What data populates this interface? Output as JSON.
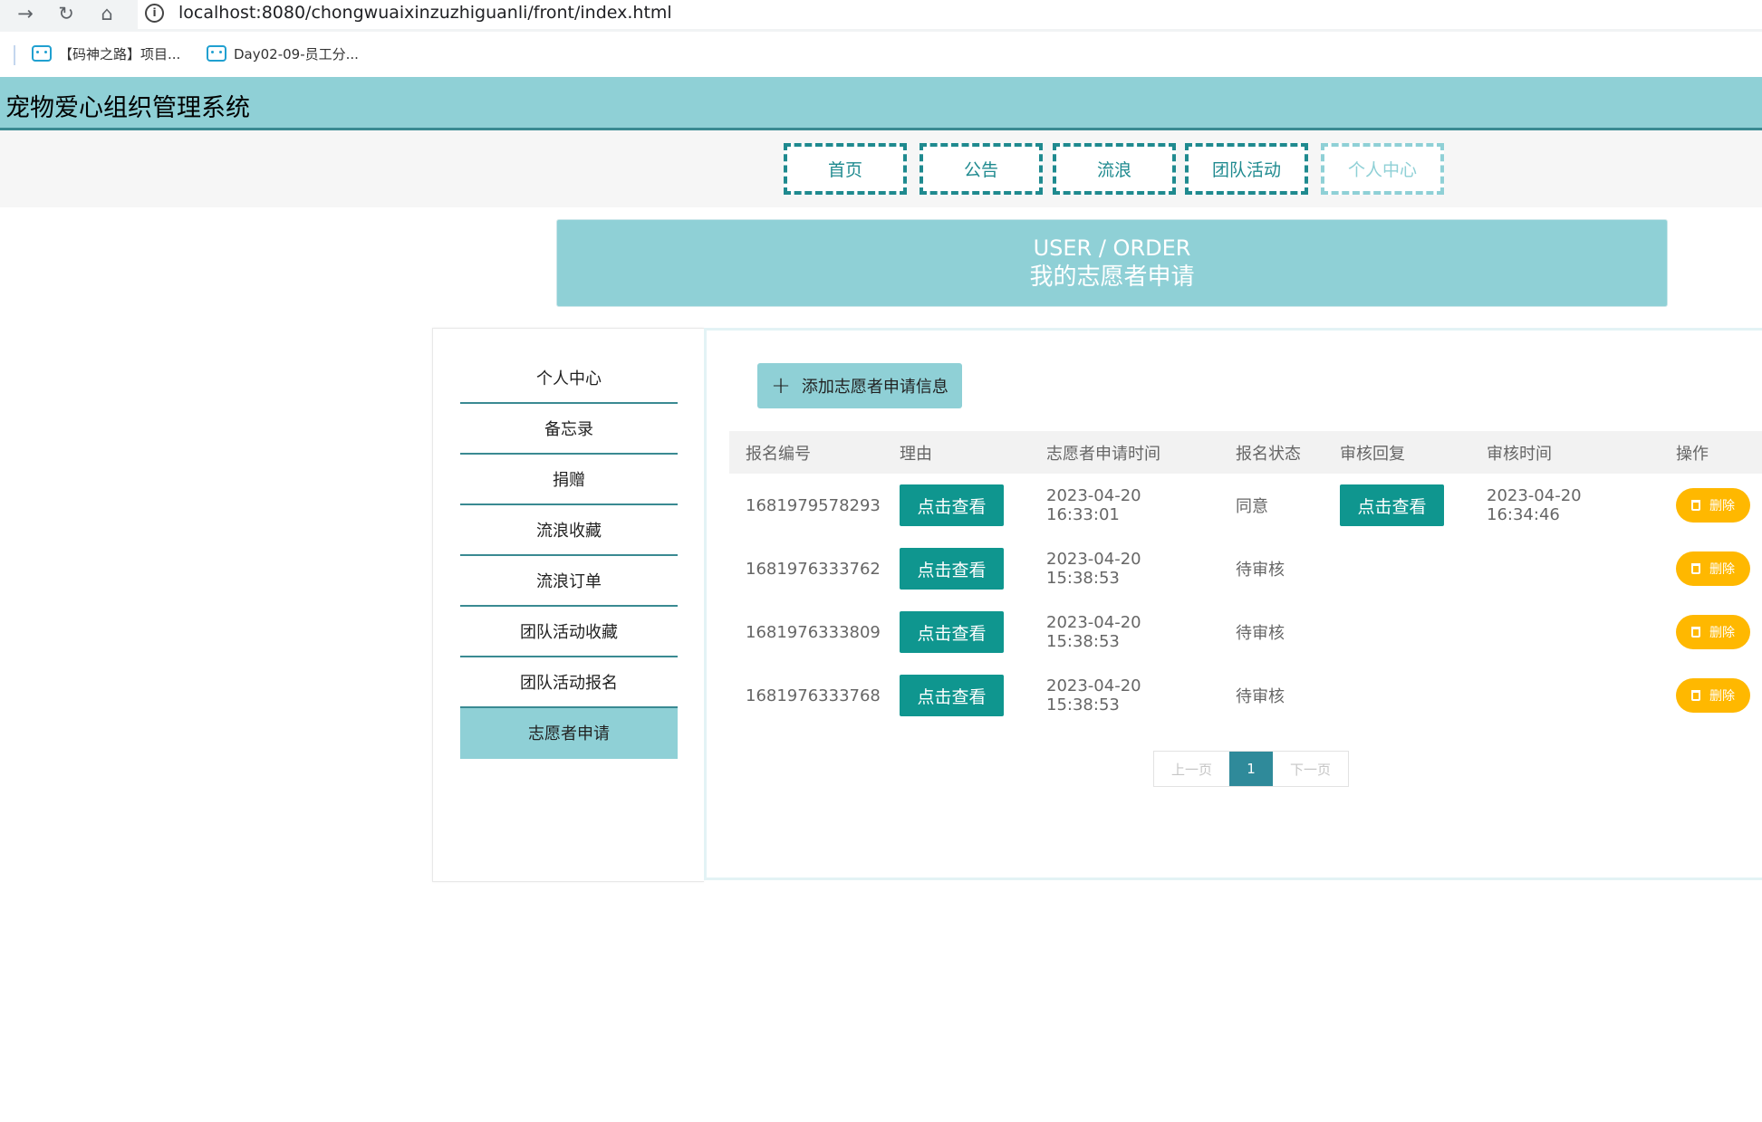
{
  "browser": {
    "url": "localhost:8080/chongwuaixinzuzhiguanli/front/index.html",
    "bookmarks": [
      {
        "label": "【码神之路】项目..."
      },
      {
        "label": "Day02-09-员工分..."
      }
    ]
  },
  "site": {
    "title": "宠物爱心组织管理系统",
    "nav": [
      "首页",
      "公告",
      "流浪",
      "团队活动",
      "个人中心"
    ],
    "active_nav": "个人中心"
  },
  "banner": {
    "en": "USER / ORDER",
    "cn": "我的志愿者申请"
  },
  "sidebar": {
    "items": [
      "个人中心",
      "备忘录",
      "捐赠",
      "流浪收藏",
      "流浪订单",
      "团队活动收藏",
      "团队活动报名",
      "志愿者申请"
    ],
    "active": "志愿者申请"
  },
  "main": {
    "add_button": "添加志愿者申请信息",
    "columns": [
      "报名编号",
      "理由",
      "志愿者申请时间",
      "报名状态",
      "审核回复",
      "审核时间",
      "操作"
    ],
    "view_label": "点击查看",
    "delete_label": "删除",
    "rows": [
      {
        "id": "1681979578293",
        "time": "2023-04-20 16:33:01",
        "status": "同意",
        "reply": "点击查看",
        "review_time": "2023-04-20 16:34:46"
      },
      {
        "id": "1681976333762",
        "time": "2023-04-20 15:38:53",
        "status": "待审核",
        "reply": "",
        "review_time": ""
      },
      {
        "id": "1681976333809",
        "time": "2023-04-20 15:38:53",
        "status": "待审核",
        "reply": "",
        "review_time": ""
      },
      {
        "id": "1681976333768",
        "time": "2023-04-20 15:38:53",
        "status": "待审核",
        "reply": "",
        "review_time": ""
      }
    ]
  },
  "pagination": {
    "prev": "上一页",
    "current": "1",
    "next": "下一页"
  }
}
